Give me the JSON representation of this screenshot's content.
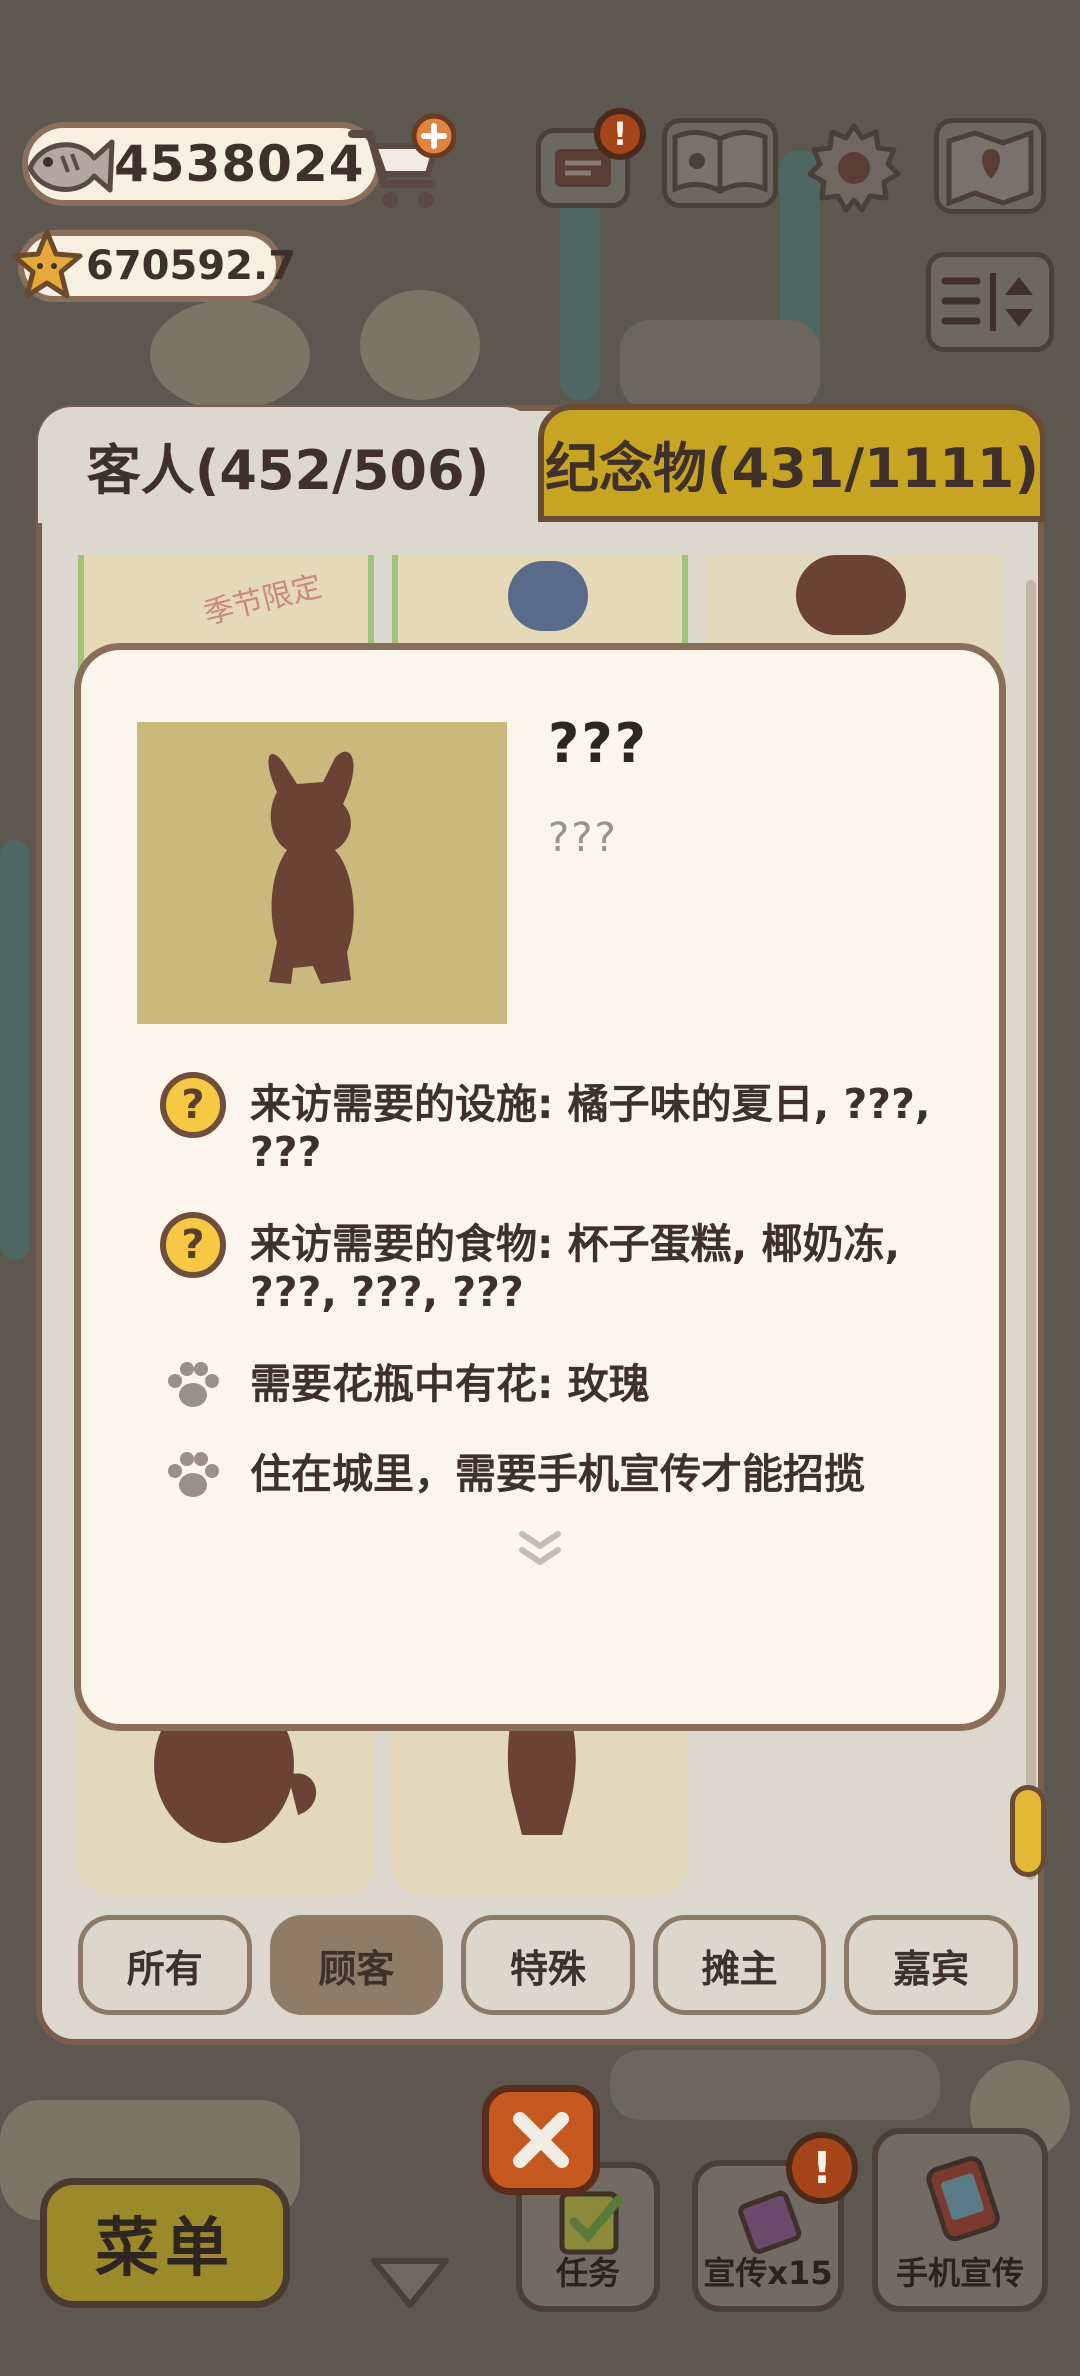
{
  "hud": {
    "fish_currency": "4538024",
    "star_currency": "670592.7"
  },
  "tabs": {
    "guests": "客人(452/506)",
    "souvenirs": "纪念物(431/1111)"
  },
  "grid": {
    "seasonal_stamp": "季节限定"
  },
  "detail": {
    "name": "???",
    "description": "???",
    "requirements": [
      {
        "icon": "question-icon",
        "text": "来访需要的设施: 橘子味的夏日, ???, ???"
      },
      {
        "icon": "question-icon",
        "text": "来访需要的食物: 杯子蛋糕, 椰奶冻, ???, ???, ???"
      },
      {
        "icon": "paw-icon",
        "text": "需要花瓶中有花: 玫瑰"
      },
      {
        "icon": "paw-icon",
        "text": "住在城里，需要手机宣传才能招揽"
      }
    ]
  },
  "filters": [
    "所有",
    "顾客",
    "特殊",
    "摊主",
    "嘉宾"
  ],
  "active_filter": "顾客",
  "bottom": {
    "menu": "菜单",
    "tasks": "任务",
    "promo": "宣传x15",
    "phone_promo": "手机宣传",
    "alert": "!"
  },
  "colors": {
    "accent_gold": "#c7a422",
    "panel": "#ddd8cd",
    "dialog": "#fbf5ec",
    "close_orange": "#c4581e",
    "silhouette": "#6a4236"
  }
}
